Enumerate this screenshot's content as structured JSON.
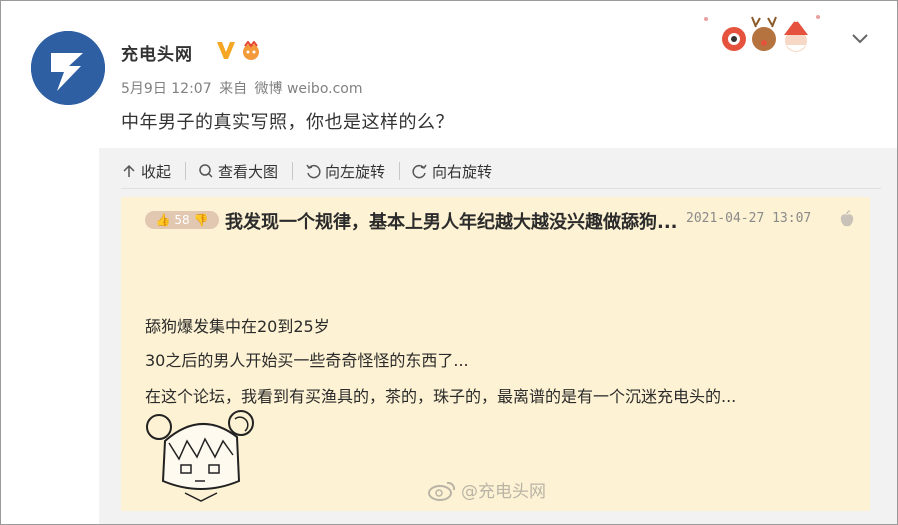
{
  "post": {
    "author": "充电头网",
    "meta_time": "5月9日 12:07",
    "meta_from": "来自",
    "meta_source": "微博 weibo.com",
    "text": "中年男子的真实写照，你也是这样的么？"
  },
  "toolbar": {
    "collapse": "收起",
    "view_large": "查看大图",
    "rotate_left": "向左旋转",
    "rotate_right": "向右旋转"
  },
  "image": {
    "like_count": "58",
    "title": "我发现一个规律，基本上男人年纪越大越没兴趣做舔狗...",
    "date": "2021-04-27 13:07",
    "lines": [
      "舔狗爆发集中在20到25岁",
      "30之后的男人开始买一些奇奇怪怪的东西了...",
      "在这个论坛，我看到有买渔具的，茶的，珠子的，最离谱的是有一个沉迷充电头的..."
    ],
    "watermark": "@充电头网"
  },
  "colors": {
    "avatar_bg": "#2e5fa3",
    "image_bg": "#fdf2d3",
    "verified": "#f5a623"
  },
  "icons": {
    "verified": "verified-v-icon",
    "fan": "fan-badge-icon",
    "chevron": "chevron-down-icon",
    "collapse": "arrow-up-icon",
    "search": "magnifier-icon",
    "rotate_left": "rotate-left-icon",
    "rotate_right": "rotate-right-icon",
    "apple": "apple-icon",
    "weibo": "weibo-logo-icon"
  }
}
